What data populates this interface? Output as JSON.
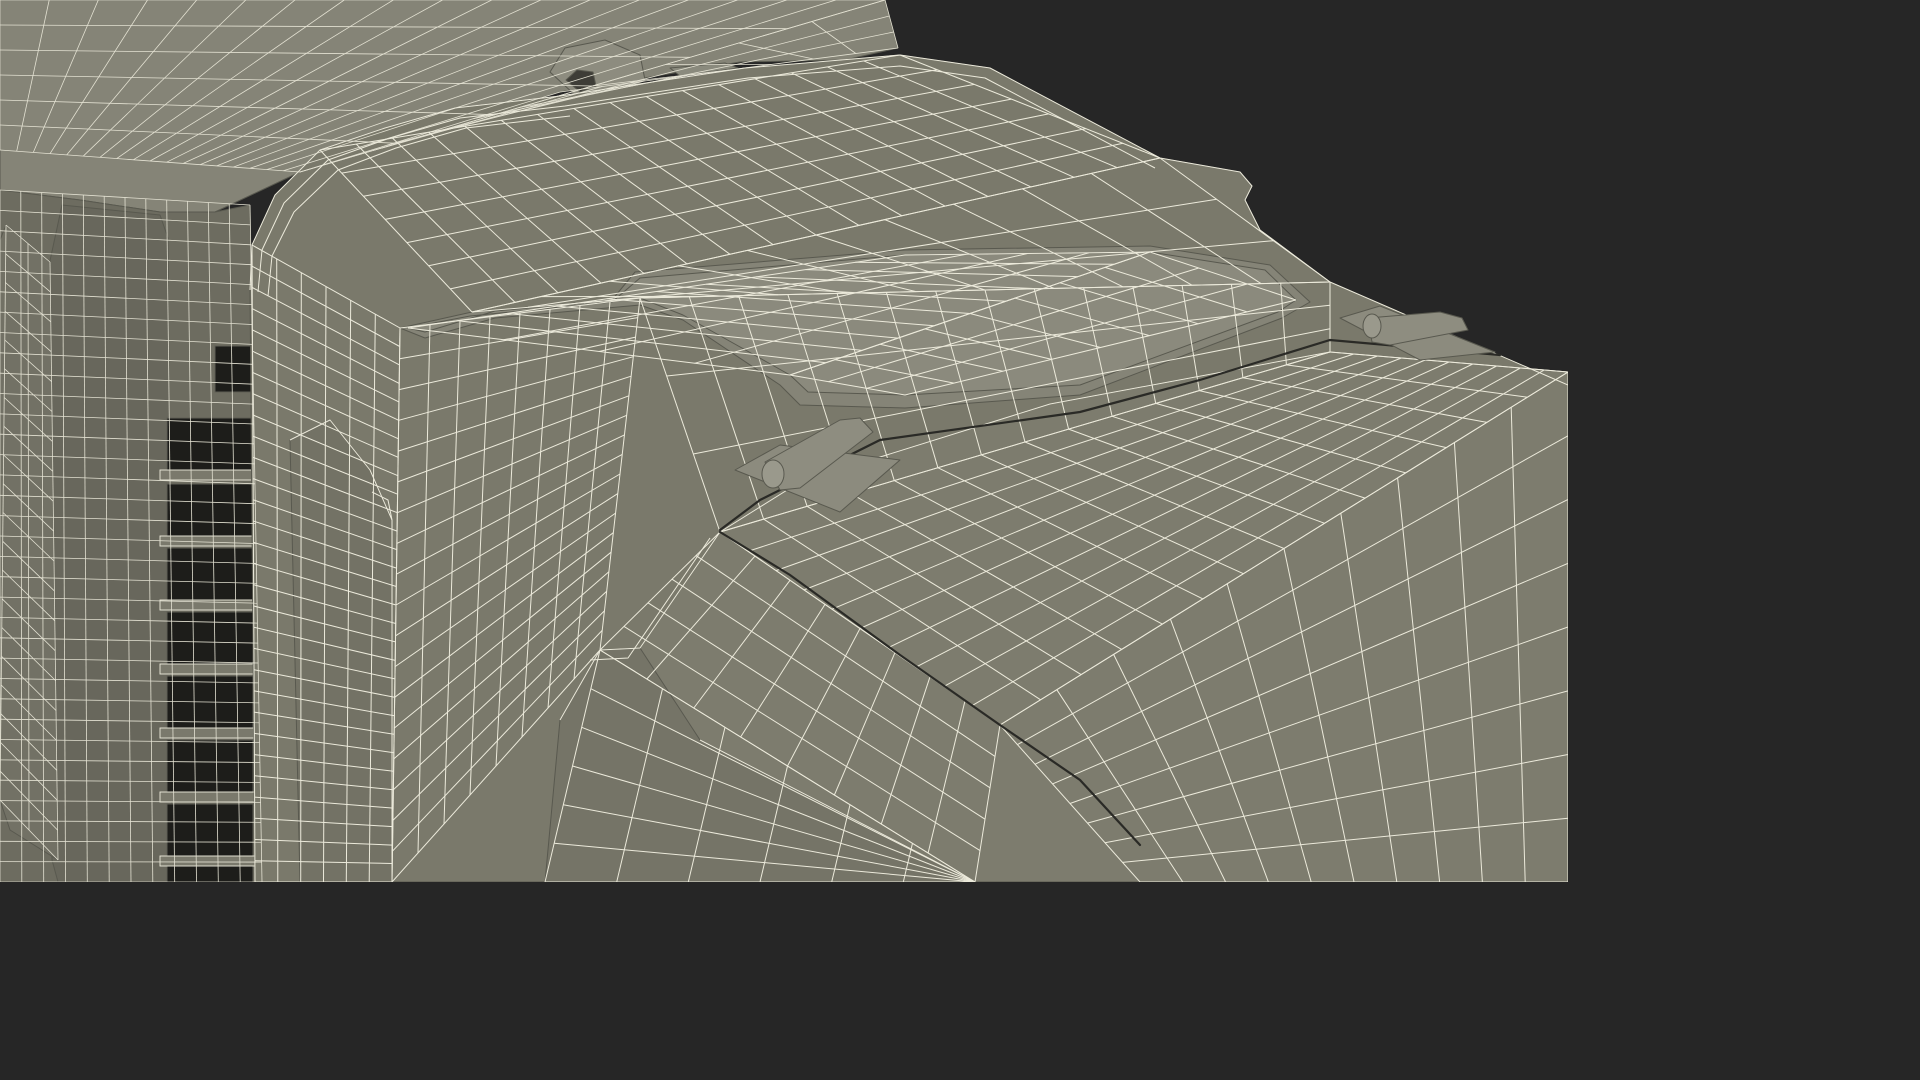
{
  "scene": {
    "background_color": "#262626",
    "model_color": "#7b7a6c",
    "wire_color": "#eceadb"
  }
}
